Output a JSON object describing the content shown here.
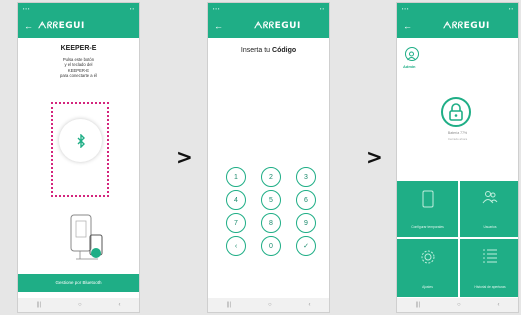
{
  "brand_color": "#1fae86",
  "highlight_color": "#d4257d",
  "separators": [
    ">",
    ">"
  ],
  "phone1": {
    "brand": "ᗅᖇᖇEGUI",
    "title": "KEEPER-E",
    "instructions": [
      "Pulsa este botón",
      "y el teclado del",
      "KEEPER-E",
      "para conectarte a él"
    ],
    "bluetooth_icon": "bluetooth-icon",
    "bottom_button": "Gestione por Bluetooth"
  },
  "phone2": {
    "brand": "ᗅᖇᖇEGUI",
    "prompt_prefix": "Inserta tu ",
    "prompt_bold": "Código",
    "keys": [
      "1",
      "2",
      "3",
      "4",
      "5",
      "6",
      "7",
      "8",
      "9",
      "‹",
      "0",
      "✓"
    ]
  },
  "phone3": {
    "brand": "ᗅᖇᖇEGUI",
    "user_label": "Admin",
    "battery_text": "Batería 77%",
    "battery_sub": "Cerrado ahora",
    "tiles": [
      {
        "label": "Configurar temporales",
        "icon": "phone-icon"
      },
      {
        "label": "Usuarios",
        "icon": "users-icon"
      },
      {
        "label": "Ajustes",
        "icon": "settings-icon"
      },
      {
        "label": "Historial de aperturas",
        "icon": "list-icon"
      }
    ]
  },
  "nav_glyphs": [
    "|||",
    "○",
    "‹"
  ]
}
